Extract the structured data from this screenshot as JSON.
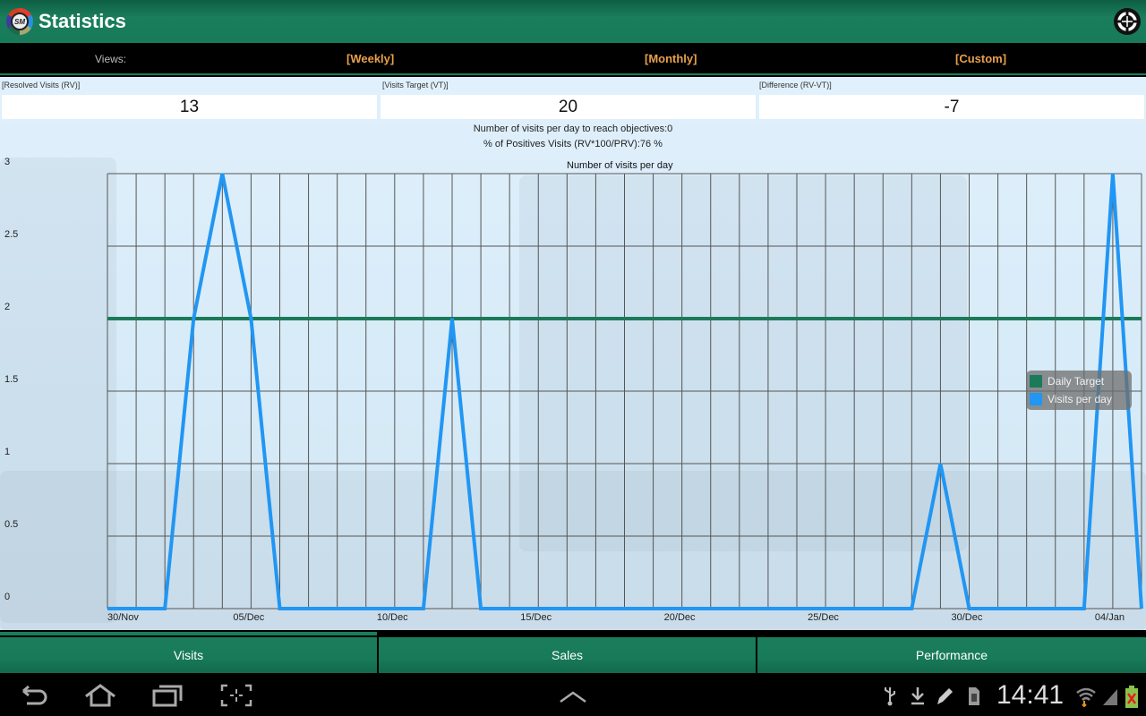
{
  "header": {
    "title": "Statistics",
    "logo_text": "SM",
    "logo_icon": "app-logo-icon",
    "action_icon": "crosshair-target-icon"
  },
  "views": {
    "label": "Views:",
    "tabs": [
      {
        "label": "[Weekly]"
      },
      {
        "label": "[Monthly]"
      },
      {
        "label": "[Custom]"
      }
    ]
  },
  "stats": {
    "resolved": {
      "label": "[Resolved Visits (RV)]",
      "value": "13"
    },
    "target": {
      "label": "[Visits Target (VT)]",
      "value": "20"
    },
    "difference": {
      "label": "[Difference (RV-VT)]",
      "value": "-7"
    }
  },
  "info": {
    "visits_needed": "Number of visits per day to reach objectives:0",
    "positive_pct": "% of Positives Visits (RV*100/PRV):76 %"
  },
  "colors": {
    "accent": "#1a7d5c",
    "target_line": "#1b7a5a",
    "visits_line": "#2196f3",
    "view_tab": "#e8a04a"
  },
  "chart_data": {
    "type": "line",
    "title": "Number of visits per day",
    "xlabel": "",
    "ylabel": "",
    "ylim": [
      0,
      3
    ],
    "y_ticks": [
      "0",
      "0.5",
      "1",
      "1.5",
      "2",
      "2.5",
      "3"
    ],
    "x_tick_labels": [
      "30/Nov",
      "05/Dec",
      "10/Dec",
      "15/Dec",
      "20/Dec",
      "25/Dec",
      "30/Dec",
      "04/Jan"
    ],
    "x_tick_every_days": 5,
    "x": [
      "30/Nov",
      "01/Dec",
      "02/Dec",
      "03/Dec",
      "04/Dec",
      "05/Dec",
      "06/Dec",
      "07/Dec",
      "08/Dec",
      "09/Dec",
      "10/Dec",
      "11/Dec",
      "12/Dec",
      "13/Dec",
      "14/Dec",
      "15/Dec",
      "16/Dec",
      "17/Dec",
      "18/Dec",
      "19/Dec",
      "20/Dec",
      "21/Dec",
      "22/Dec",
      "23/Dec",
      "24/Dec",
      "25/Dec",
      "26/Dec",
      "27/Dec",
      "28/Dec",
      "29/Dec",
      "30/Dec",
      "31/Dec",
      "01/Jan",
      "02/Jan",
      "03/Jan",
      "04/Jan",
      "05/Jan"
    ],
    "grid": true,
    "legend_position": "right",
    "series": [
      {
        "name": "Daily Target",
        "color": "#1b7a5a",
        "values": [
          2,
          2,
          2,
          2,
          2,
          2,
          2,
          2,
          2,
          2,
          2,
          2,
          2,
          2,
          2,
          2,
          2,
          2,
          2,
          2,
          2,
          2,
          2,
          2,
          2,
          2,
          2,
          2,
          2,
          2,
          2,
          2,
          2,
          2,
          2,
          2,
          2
        ]
      },
      {
        "name": "Visits per day",
        "color": "#2196f3",
        "values": [
          0,
          0,
          0,
          2,
          3,
          2,
          0,
          0,
          0,
          0,
          0,
          0,
          2,
          0,
          0,
          0,
          0,
          0,
          0,
          0,
          0,
          0,
          0,
          0,
          0,
          0,
          0,
          0,
          0,
          1,
          0,
          0,
          0,
          0,
          0,
          3,
          0
        ]
      }
    ]
  },
  "bottom_tabs": [
    {
      "label": "Visits",
      "selected": true
    },
    {
      "label": "Sales",
      "selected": false
    },
    {
      "label": "Performance",
      "selected": false
    }
  ],
  "system_bar": {
    "nav": [
      "back-icon",
      "home-icon",
      "recent-apps-icon",
      "screenshot-icon",
      "chevron-up-icon"
    ],
    "status_icons": [
      "usb-icon",
      "download-icon",
      "pen-icon",
      "sd-card-icon",
      "wifi-icon",
      "signal-icon",
      "battery-icon"
    ],
    "time": "14:41"
  }
}
